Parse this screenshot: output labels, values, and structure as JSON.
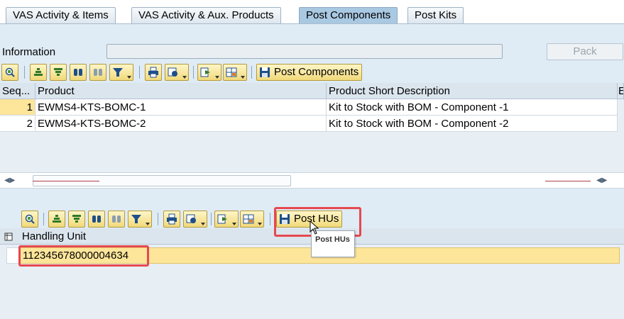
{
  "tabs": [
    {
      "label": "VAS Activity & Items",
      "active": false
    },
    {
      "label": "VAS Activity & Aux. Products",
      "active": false
    },
    {
      "label": "Post Components",
      "active": true
    },
    {
      "label": "Post Kits",
      "active": false
    }
  ],
  "info": {
    "label": "Information",
    "value": "",
    "pack_label": "Pack"
  },
  "toolbar1": {
    "post_components_label": "Post Components"
  },
  "grid1": {
    "columns": [
      "Seq...",
      "Product",
      "Product Short Description",
      "E"
    ],
    "rows": [
      {
        "seq": "1",
        "product": "EWMS4-KTS-BOMC-1",
        "description": "Kit to Stock with BOM - Component -1"
      },
      {
        "seq": "2",
        "product": "EWMS4-KTS-BOMC-2",
        "description": "Kit to Stock with BOM - Component -2"
      }
    ]
  },
  "toolbar2": {
    "post_hus_label": "Post HUs",
    "tooltip": "Post HUs"
  },
  "grid2": {
    "column": "Handling Unit",
    "rows": [
      {
        "hu": "112345678000004634"
      }
    ]
  },
  "icons": {
    "details": "details-icon",
    "sort_asc": "sort-ascending-icon",
    "sort_desc": "sort-descending-icon",
    "find": "find-icon",
    "find_next": "find-next-icon",
    "filter": "filter-icon",
    "print": "print-icon",
    "views": "views-icon",
    "export": "export-icon",
    "layout": "layout-icon",
    "save": "save-icon"
  },
  "colors": {
    "highlight": "#e5494f",
    "selected_row": "#fde59a",
    "active_tab": "#a9c8e2"
  }
}
